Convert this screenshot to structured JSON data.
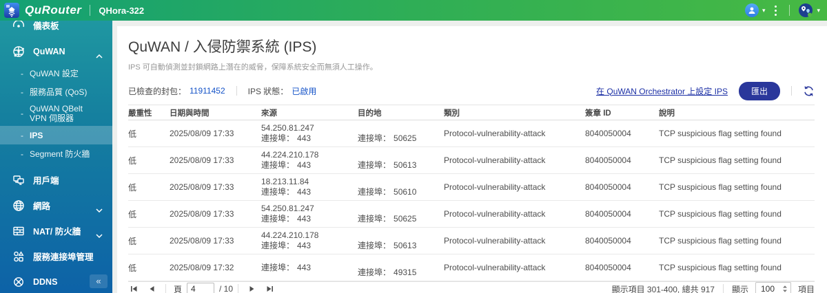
{
  "header": {
    "brand": "QuRouter",
    "model": "QHora-322"
  },
  "sidebar": {
    "items": [
      {
        "label": "儀表板",
        "icon": "dashboard-gauge"
      },
      {
        "label": "QuWAN",
        "icon": "quwan-globe",
        "expanded": true,
        "children": [
          {
            "label": "QuWAN 設定"
          },
          {
            "label": "服務品質 (QoS)"
          },
          {
            "label": "QuWAN QBelt VPN 伺服器"
          },
          {
            "label": "IPS",
            "active": true
          },
          {
            "label": "Segment 防火牆"
          }
        ]
      },
      {
        "label": "用戶端",
        "icon": "clients"
      },
      {
        "label": "網路",
        "icon": "network-globe",
        "collapsed": true
      },
      {
        "label": "NAT/ 防火牆",
        "icon": "firewall-wall",
        "collapsed": true
      },
      {
        "label": "服務連接埠管理",
        "icon": "service-ports"
      },
      {
        "label": "DDNS",
        "icon": "ddns"
      }
    ],
    "collapse_glyph": "«"
  },
  "page": {
    "title": "QuWAN / 入侵防禦系統 (IPS)",
    "subtitle": "IPS 可自動偵測並封鎖網路上潛在的威脅，保障系統安全而無須人工操作。",
    "stats": {
      "packets_label": "已檢查的封包：",
      "packets_value": "11911452",
      "status_label": "IPS 狀態：",
      "status_value": "已啟用"
    },
    "orchestrator_link": "在 QuWAN Orchestrator 上設定 IPS",
    "export_button": "匯出"
  },
  "table": {
    "columns": [
      "嚴重性",
      "日期與時間",
      "來源",
      "目的地",
      "類別",
      "簽章 ID",
      "說明"
    ],
    "port_label": "連接埠：",
    "rows": [
      {
        "severity": "低",
        "datetime": "2025/08/09 17:33",
        "src_ip": "54.250.81.247",
        "src_port": "443",
        "dst_port": "50625",
        "category": "Protocol-vulnerability-attack",
        "sig_id": "8040050004",
        "description": "TCP suspicious flag setting found"
      },
      {
        "severity": "低",
        "datetime": "2025/08/09 17:33",
        "src_ip": "44.224.210.178",
        "src_port": "443",
        "dst_port": "50613",
        "category": "Protocol-vulnerability-attack",
        "sig_id": "8040050004",
        "description": "TCP suspicious flag setting found"
      },
      {
        "severity": "低",
        "datetime": "2025/08/09 17:33",
        "src_ip": "18.213.11.84",
        "src_port": "443",
        "dst_port": "50610",
        "category": "Protocol-vulnerability-attack",
        "sig_id": "8040050004",
        "description": "TCP suspicious flag setting found"
      },
      {
        "severity": "低",
        "datetime": "2025/08/09 17:33",
        "src_ip": "54.250.81.247",
        "src_port": "443",
        "dst_port": "50625",
        "category": "Protocol-vulnerability-attack",
        "sig_id": "8040050004",
        "description": "TCP suspicious flag setting found"
      },
      {
        "severity": "低",
        "datetime": "2025/08/09 17:33",
        "src_ip": "44.224.210.178",
        "src_port": "443",
        "dst_port": "50613",
        "category": "Protocol-vulnerability-attack",
        "sig_id": "8040050004",
        "description": "TCP suspicious flag setting found"
      },
      {
        "severity": "低",
        "datetime": "2025/08/09 17:32",
        "src_ip": "",
        "src_port": "443",
        "dst_port": "49315",
        "category": "Protocol-vulnerability-attack",
        "sig_id": "8040050004",
        "description": "TCP suspicious flag setting found"
      }
    ]
  },
  "pagination": {
    "page_label": "頁",
    "current_page": "4",
    "total_pages": "/ 10",
    "items_info": "顯示項目 301-400, 總共 917",
    "show_label": "顯示",
    "page_size": "100",
    "items_label": "項目"
  },
  "colors": {
    "value_blue": "#1553c8",
    "link_navy": "#1b2fa5",
    "export_button": "#2a379b",
    "topbar_green_start": "#13a075",
    "topbar_green_end": "#47b943",
    "sidebar_teal": "#1f97a1",
    "sidebar_blue": "#0d62a7"
  }
}
